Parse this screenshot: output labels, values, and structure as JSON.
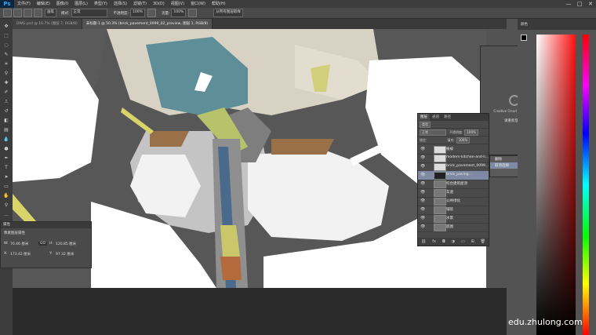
{
  "app": {
    "logo": "Ps"
  },
  "menu": [
    "文件(F)",
    "编辑(E)",
    "图像(I)",
    "图层(L)",
    "类型(Y)",
    "选择(S)",
    "滤镜(T)",
    "3D(D)",
    "视图(V)",
    "窗口(W)",
    "帮助(H)"
  ],
  "window_controls": [
    "—",
    "□",
    "✕"
  ],
  "options_bar": {
    "brush_size_label": "画笔",
    "mode_label": "模式:",
    "mode_value": "正常",
    "opacity_label": "不透明度:",
    "opacity_value": "100%",
    "flow_label": "流量:",
    "flow_value": "100%",
    "extra_button": "从所有图层取样"
  },
  "document_tabs": [
    {
      "label": "DWG.psd @ 16.7% (图层 7, RGB/8)",
      "active": false
    },
    {
      "label": "未标题-1 @ 50.3% (brick_pavement_0099_02_preview, 图层 1, RGB/8)",
      "active": true
    }
  ],
  "properties": {
    "tab": "属性",
    "title": "像素图层属性",
    "w_label": "W:",
    "w_value": "76.46 厘米",
    "h_label": "H:",
    "h_value": "120.85 厘米",
    "x_label": "X:",
    "x_value": "173.42 厘米",
    "y_label": "Y:",
    "y_value": "97.32 厘米",
    "link_label": "GO"
  },
  "layers_panel": {
    "tabs": [
      "图层",
      "通道",
      "路径"
    ],
    "kind_label": "类型",
    "blend_mode": "正常",
    "opacity_label": "不透明度:",
    "opacity_value": "100%",
    "lock_label": "锁定:",
    "fill_label": "填充:",
    "fill_value": "100%",
    "layers": [
      {
        "name": "植被",
        "selected": false
      },
      {
        "name": "modern-kitchen-and-li...",
        "selected": false
      },
      {
        "name": "brick_pavement_0099...",
        "selected": false
      },
      {
        "name": "brick_paving...",
        "selected": true
      },
      {
        "name": "综合建筑屋顶",
        "selected": false
      },
      {
        "name": "车道",
        "selected": false
      },
      {
        "name": "公共绿化",
        "selected": false
      },
      {
        "name": "铺装",
        "selected": false
      },
      {
        "name": "水景",
        "selected": false
      },
      {
        "name": "底图",
        "selected": false
      }
    ]
  },
  "libraries": {
    "message_line1": "Creative Cloud Libraries 无法连接",
    "link_text": "请重新登录"
  },
  "context_menu": [
    "删除",
    "取消选择"
  ],
  "color_panel": {
    "tab": "颜色"
  },
  "watermark": "edu.zhulong.com",
  "colors": {
    "accent": "#31a8ff",
    "panel": "#4a4a4a",
    "selected_layer": "#7e8aa3"
  }
}
